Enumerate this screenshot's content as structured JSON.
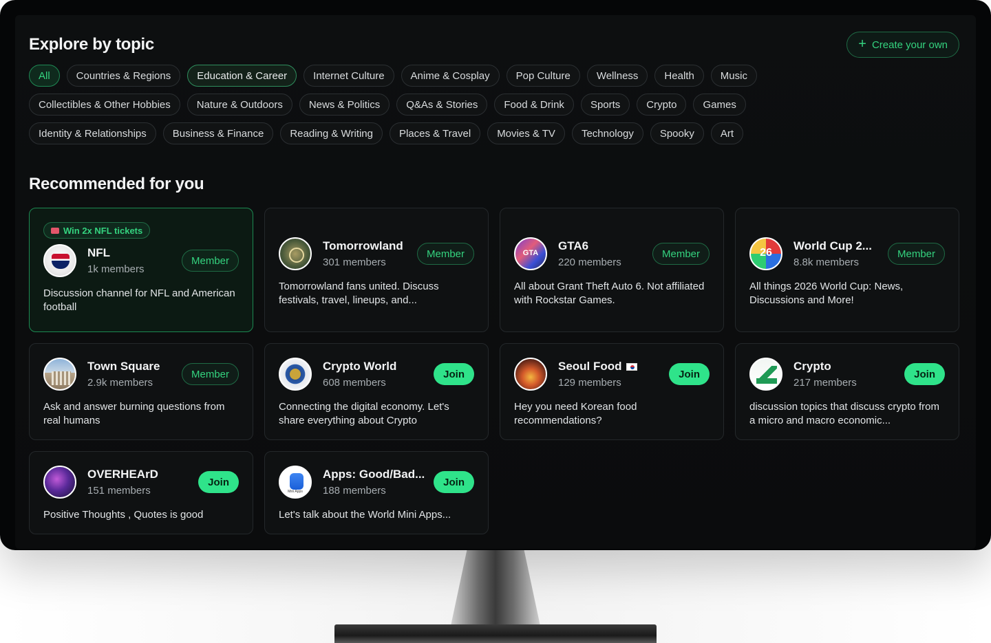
{
  "explore": {
    "title": "Explore by topic",
    "create_label": "Create your own",
    "topics": [
      [
        "All",
        "Countries & Regions",
        "Education & Career",
        "Internet Culture",
        "Anime & Cosplay",
        "Pop Culture",
        "Wellness",
        "Health",
        "Music"
      ],
      [
        "Collectibles & Other Hobbies",
        "Nature & Outdoors",
        "News & Politics",
        "Q&As & Stories",
        "Food & Drink",
        "Sports",
        "Crypto",
        "Games"
      ],
      [
        "Identity & Relationships",
        "Business & Finance",
        "Reading & Writing",
        "Places & Travel",
        "Movies & TV",
        "Technology",
        "Spooky",
        "Art"
      ]
    ],
    "active_topic": "All",
    "selected_topic": "Education & Career"
  },
  "recommended": {
    "title": "Recommended for you",
    "cards": [
      {
        "name": "NFL",
        "members": "1k members",
        "status": "Member",
        "desc": "Discussion channel for NFL and American football",
        "promo": "Win 2x NFL tickets",
        "avatar": "av-nfl",
        "highlight": true
      },
      {
        "name": "Tomorrowland",
        "members": "301 members",
        "status": "Member",
        "desc": "Tomorrowland fans united. Discuss festivals, travel, lineups, and...",
        "avatar": "av-tmr"
      },
      {
        "name": "GTA6",
        "members": "220 members",
        "status": "Member",
        "desc": "All about Grant Theft Auto 6. Not affiliated with Rockstar Games.",
        "avatar": "av-gta"
      },
      {
        "name": "World Cup 2...",
        "members": "8.8k members",
        "status": "Member",
        "desc": "All things 2026 World Cup: News, Discussions and More!",
        "avatar": "av-wc"
      },
      {
        "name": "Town Square",
        "members": "2.9k members",
        "status": "Member",
        "desc": "Ask and answer burning questions from real humans",
        "avatar": "av-ts"
      },
      {
        "name": "Crypto World",
        "members": "608 members",
        "status": "Join",
        "desc": "Connecting the digital economy. Let's share everything about Crypto",
        "avatar": "av-cw"
      },
      {
        "name": "Seoul Food",
        "members": "129 members",
        "status": "Join",
        "desc": "Hey you need Korean food recommendations?",
        "avatar": "av-sf",
        "flag": "korea-flag-icon"
      },
      {
        "name": "Crypto",
        "members": "217 members",
        "status": "Join",
        "desc": "discussion topics that discuss crypto from a micro and macro economic...",
        "avatar": "av-cr"
      },
      {
        "name": "OVERHEArD",
        "members": "151 members",
        "status": "Join",
        "desc": "Positive Thoughts , Quotes is good",
        "avatar": "av-oh"
      },
      {
        "name": "Apps: Good/Bad...",
        "members": "188 members",
        "status": "Join",
        "desc": "Let's talk about the World Mini Apps...",
        "avatar": "av-ap"
      }
    ]
  },
  "colors": {
    "accent": "#34d37f",
    "join": "#2fe38a",
    "background": "#0b0c0d"
  }
}
